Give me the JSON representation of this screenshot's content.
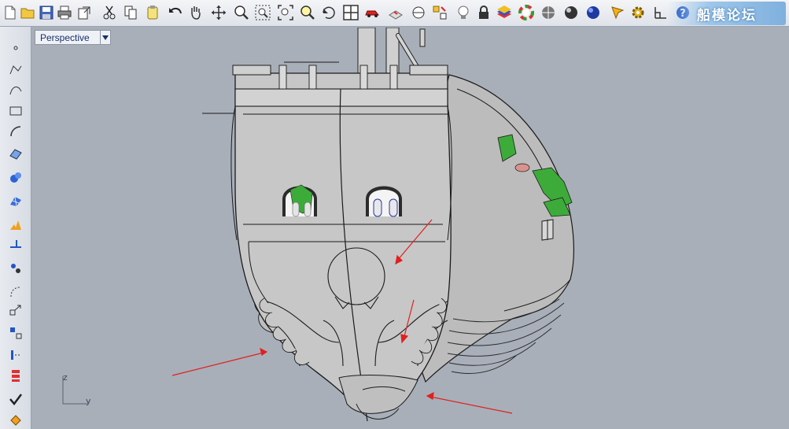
{
  "viewport": {
    "tab_label": "Perspective",
    "axis_labels": {
      "z": "z",
      "y": "y"
    }
  },
  "toolbar": {
    "icons": [
      "new-file-icon",
      "open-folder-icon",
      "save-icon",
      "print-icon",
      "import-icon",
      "cut-icon",
      "copy-icon",
      "paste-icon",
      "undo-icon",
      "pan-hand-icon",
      "move-view-icon",
      "zoom-icon",
      "zoom-window-icon",
      "zoom-extents-icon",
      "zoom-selected-icon",
      "rotate-view-icon",
      "four-viewports-icon",
      "car-icon",
      "layer-icon",
      "grid-snap-icon",
      "select-points-icon",
      "light-bulb-icon",
      "lock-icon",
      "layers-color-icon",
      "color-wheel-icon",
      "shaded-sphere-icon",
      "rendered-sphere-icon",
      "blue-sphere-icon",
      "highlight-icon",
      "gear-settings-icon",
      "dimension-icon",
      "help-icon"
    ]
  },
  "watermark": {
    "text": "船模论坛"
  },
  "colors": {
    "viewport_bg": "#a8afb9",
    "hull": "#c8c8c8",
    "outline": "#1b1b1b",
    "green_decor": "#3dab3a",
    "annotation_arrows": "#e02020"
  }
}
